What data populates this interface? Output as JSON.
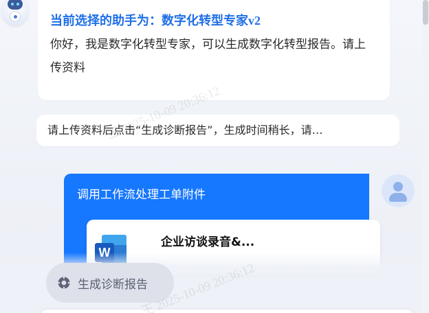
{
  "assistant": {
    "title": "当前选择的助手为：数字化转型专家v2",
    "greeting": "你好，我是数字化转型专家，可以生成数字化转型报告。请上传资料"
  },
  "hint_message": "请上传资料后点击“生成诊断报告”，生成时间稍长，请…",
  "user_message": {
    "title": "调用工作流处理工单附件",
    "attachment": {
      "icon": "word-document-icon",
      "icon_letter": "W",
      "name": "企业访谈录音&..."
    }
  },
  "action": {
    "label": "生成诊断报告",
    "icon": "gear-icon"
  },
  "watermark": {
    "text": "王 2025-10-09 20:36:12"
  },
  "colors": {
    "accent": "#1677ff",
    "title_blue": "#1f6fe6",
    "chip_bg": "#dfe1ea"
  }
}
